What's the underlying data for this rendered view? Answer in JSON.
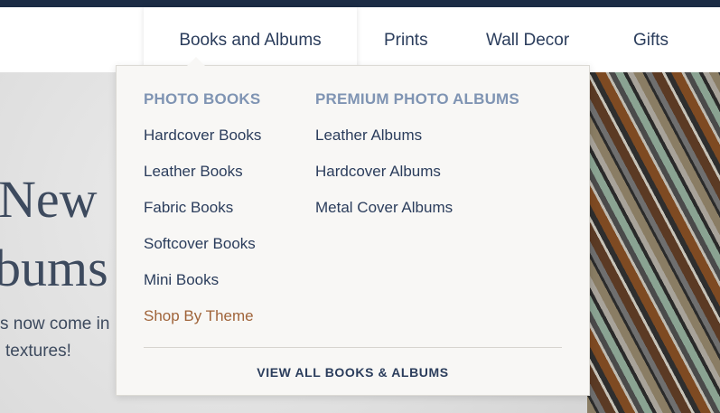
{
  "nav": {
    "items": [
      {
        "label": "Books and Albums"
      },
      {
        "label": "Prints"
      },
      {
        "label": "Wall Decor"
      },
      {
        "label": "Gifts"
      }
    ]
  },
  "hero": {
    "title_line1": "New",
    "title_line2": "bums",
    "text_line1": "s now come in",
    "text_line2": "textures!"
  },
  "dropdown": {
    "photo_books": {
      "heading": "PHOTO BOOKS",
      "items": [
        "Hardcover Books",
        "Leather Books",
        "Fabric Books",
        "Softcover Books",
        "Mini Books",
        "Shop By Theme"
      ]
    },
    "premium_albums": {
      "heading": "PREMIUM PHOTO ALBUMS",
      "items": [
        "Leather Albums",
        "Hardcover Albums",
        "Metal Cover Albums"
      ]
    },
    "view_all": "VIEW ALL BOOKS & ALBUMS"
  },
  "colors": {
    "topbar": "#1c2c45",
    "nav_text": "#2b3d5c",
    "heading": "#7f94b3",
    "accent_link": "#a0643a"
  }
}
